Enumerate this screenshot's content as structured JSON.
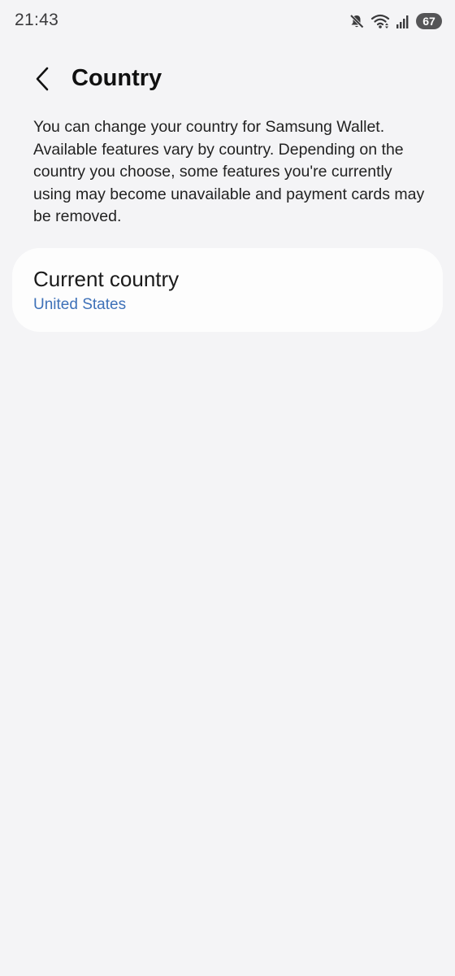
{
  "status_bar": {
    "time": "21:43",
    "battery_level": "67",
    "icons": [
      "mute-icon",
      "wifi-icon",
      "signal-icon",
      "battery-icon"
    ]
  },
  "header": {
    "title": "Country",
    "back_icon": "chevron-left-icon"
  },
  "description": "You can change your country for Samsung Wallet. Available features vary by country. Depending on the country you choose, some features you're currently using may become unavailable and payment cards may be removed.",
  "current_country": {
    "label": "Current country",
    "value": "United States"
  },
  "colors": {
    "background": "#f4f4f6",
    "card": "#fdfdfd",
    "accent": "#3e71b8"
  }
}
